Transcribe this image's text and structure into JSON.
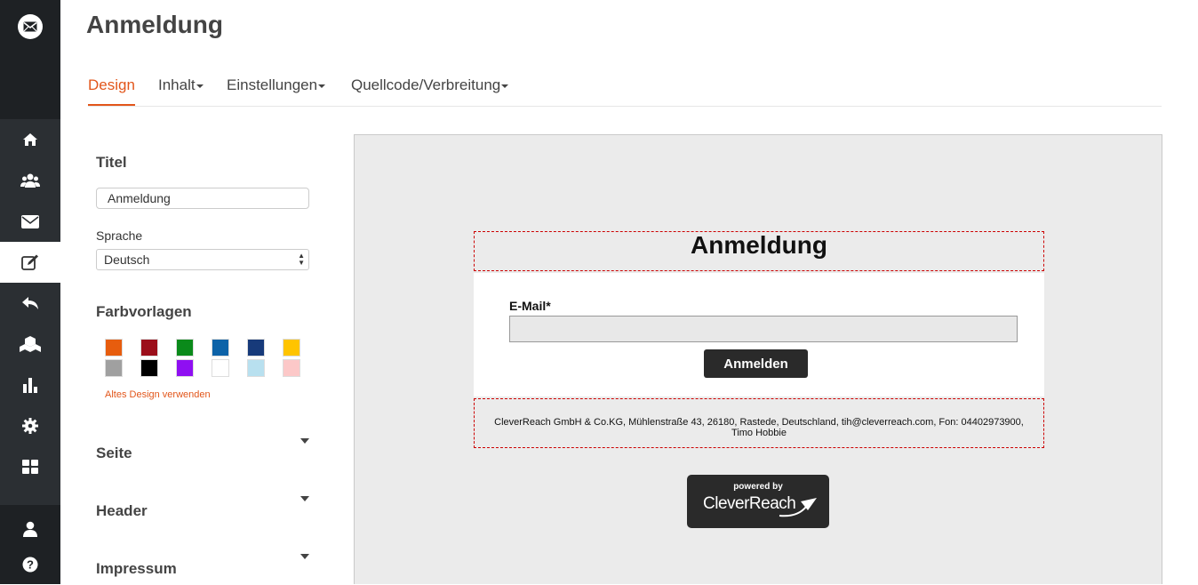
{
  "page_title": "Anmeldung",
  "tabs": [
    {
      "label": "Design",
      "active": true,
      "dropdown": false
    },
    {
      "label": "Inhalt",
      "active": false,
      "dropdown": true
    },
    {
      "label": "Einstellungen",
      "active": false,
      "dropdown": true
    },
    {
      "label": "Quellcode/Verbreitung",
      "active": false,
      "dropdown": true
    }
  ],
  "sidebar": {
    "items": [
      {
        "icon": "home-icon"
      },
      {
        "icon": "users-icon"
      },
      {
        "icon": "envelope-icon"
      },
      {
        "icon": "edit-icon",
        "active": true
      },
      {
        "icon": "reply-icon"
      },
      {
        "icon": "cubes-icon"
      },
      {
        "icon": "bar-chart-icon"
      },
      {
        "icon": "gear-icon"
      },
      {
        "icon": "grid-icon"
      }
    ],
    "bottom": [
      {
        "icon": "user-icon"
      },
      {
        "icon": "help-icon"
      }
    ]
  },
  "left": {
    "titel_heading": "Titel",
    "titel_value": "Anmeldung",
    "sprache_label": "Sprache",
    "sprache_value": "Deutsch",
    "farbvorlagen_heading": "Farbvorlagen",
    "swatches": [
      "#e75d0e",
      "#9b0e1a",
      "#0a8a1a",
      "#0d63a8",
      "#173a7a",
      "#ffc400",
      "#a0a0a0",
      "#000000",
      "#8f0ff2",
      "#ffffff",
      "#b8e0ef",
      "#fcc8c8"
    ],
    "old_design_link": "Altes Design verwenden",
    "sections": [
      "Seite",
      "Header",
      "Impressum"
    ]
  },
  "preview": {
    "form_title": "Anmeldung",
    "email_label": "E-Mail*",
    "submit_label": "Anmelden",
    "footer_line1": "CleverReach GmbH & Co.KG, Mühlenstraße 43, 26180, Rastede, Deutschland, tih@cleverreach.com, Fon: 04402973900,",
    "footer_line2": "Timo Hobbie",
    "powered_by": "powered by",
    "brand": "CleverReach"
  }
}
